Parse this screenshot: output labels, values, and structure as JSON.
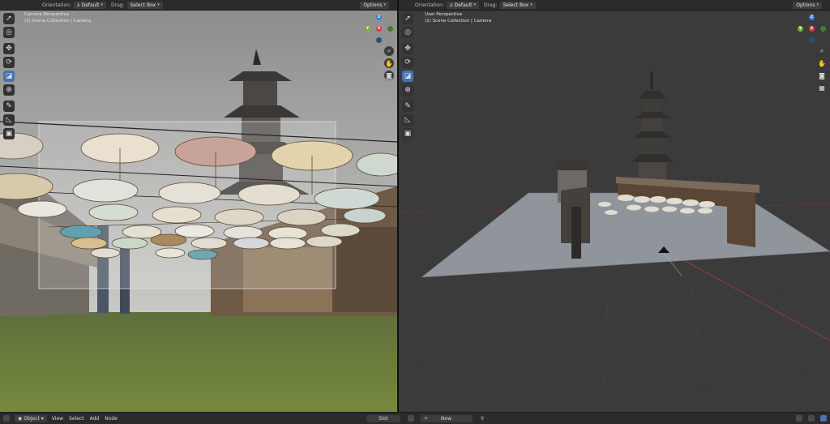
{
  "left_viewport": {
    "header": {
      "orientation_label": "Orientation:",
      "orientation_value": "Default",
      "drag_label": "Drag:",
      "drag_value": "Select Box",
      "options_label": "Options"
    },
    "overlay": {
      "perspective": "Camera Perspective",
      "collection": "(1) Scene Collection | Camera"
    },
    "gizmo_labels": {
      "z": "Z",
      "y": "Y",
      "x": "X"
    }
  },
  "right_viewport": {
    "header": {
      "orientation_label": "Orientation:",
      "orientation_value": "Default",
      "drag_label": "Drag:",
      "drag_value": "Select Box",
      "options_label": "Options"
    },
    "overlay": {
      "perspective": "User Perspective",
      "collection": "(1) Scene Collection | Camera"
    },
    "gizmo_labels": {
      "z": "Z",
      "y": "Y",
      "x": "X"
    }
  },
  "statusbar": {
    "mode": "Object",
    "menus": [
      "View",
      "Select",
      "Add",
      "Node"
    ],
    "slot_label": "Slot",
    "new_label": "New"
  },
  "colors": {
    "accent": "#4772b3",
    "axis_x": "#d33c4a",
    "axis_y": "#7fb52b",
    "axis_z": "#3c7fd6"
  }
}
